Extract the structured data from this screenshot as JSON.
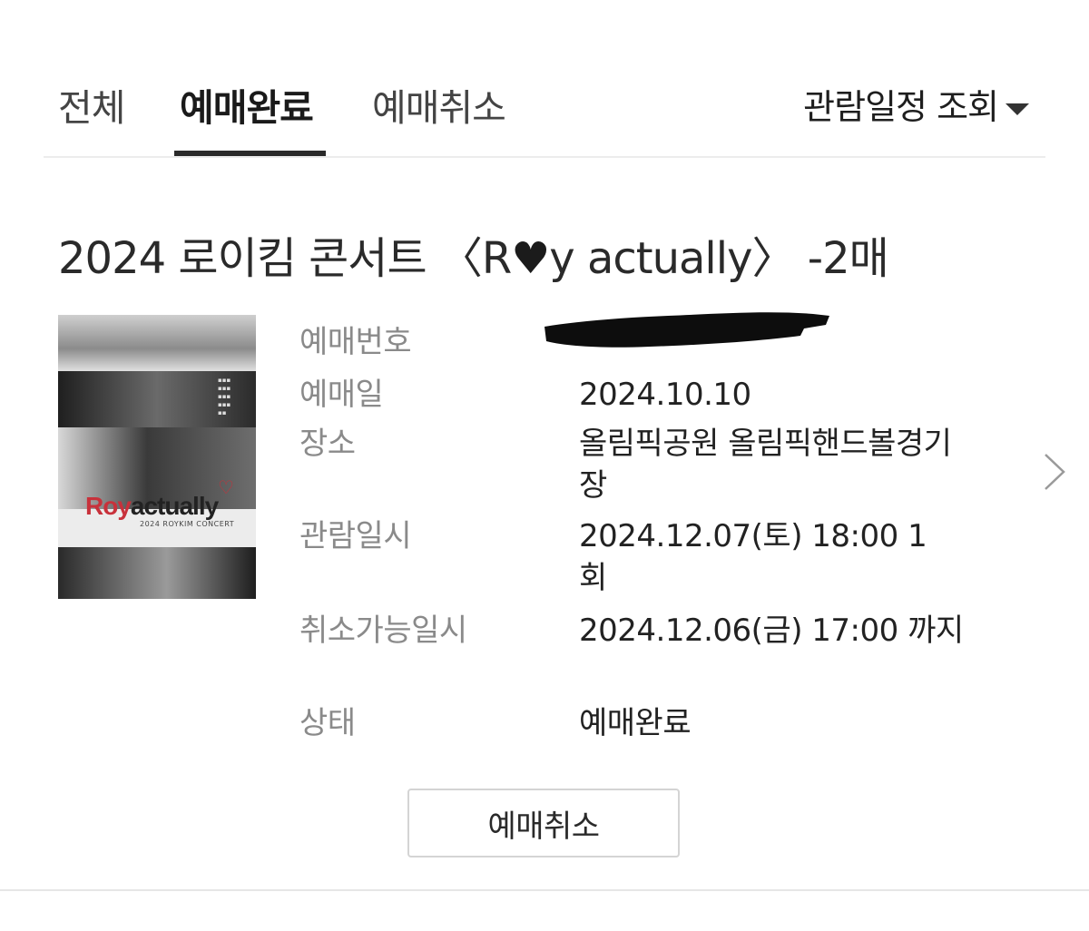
{
  "tabs": [
    {
      "label": "전체",
      "active": false
    },
    {
      "label": "예매완료",
      "active": true
    },
    {
      "label": "예매취소",
      "active": false
    }
  ],
  "schedule_filter": {
    "label": "관람일정 조회"
  },
  "booking": {
    "title_prefix": "2024 로이킴 콘서트 〈R",
    "title_heart": "♥",
    "title_suffix": "y actually〉 -2매",
    "poster": {
      "logo_roy": "Roy",
      "logo_actually": "actually",
      "subtitle": "2024 ROYKIM CONCERT"
    },
    "fields": [
      {
        "label": "예매번호",
        "value": ""
      },
      {
        "label": "예매일",
        "value": "2024.10.10"
      },
      {
        "label": "장소",
        "value": "올림픽공원 올림픽핸드볼경기장"
      },
      {
        "label": "관람일시",
        "value": "2024.12.07(토) 18:00 1회"
      },
      {
        "label": "취소가능일시",
        "value": "2024.12.06(금) 17:00 까지"
      },
      {
        "label": "상태",
        "value": "예매완료"
      }
    ],
    "cancel_button": "예매취소"
  },
  "colors": {
    "accent": "#2a2a2a",
    "label_gray": "#8a8a8a",
    "poster_red": "#c8313b"
  }
}
